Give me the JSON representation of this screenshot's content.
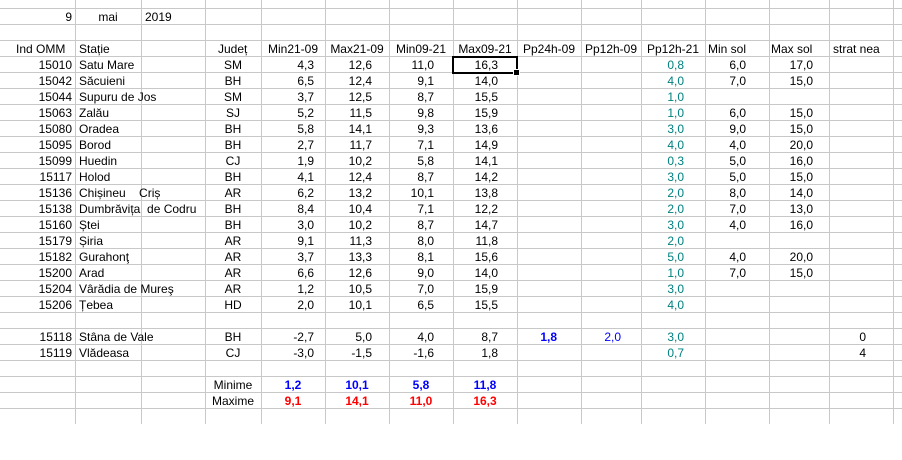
{
  "date": {
    "day": "9",
    "month": "mai",
    "year": "2019"
  },
  "headers": [
    "Ind OMM",
    "Stație",
    "Județ",
    "Min21-09",
    "Max21-09",
    "Min09-21",
    "Max09-21",
    "Pp24h-09",
    "Pp12h-09",
    "Pp12h-21",
    "Min sol",
    "Max sol",
    "strat nea"
  ],
  "rows": [
    {
      "id": "15010",
      "name": "Satu Mare",
      "county": "SM",
      "min21": "4,3",
      "max21": "12,6",
      "min09": "11,0",
      "max09": "16,3",
      "pp24": "",
      "pp12a": "",
      "pp12b": "0,8",
      "minsol": "6,0",
      "maxsol": "17,0",
      "snow": ""
    },
    {
      "id": "15042",
      "name": "Săcuieni",
      "county": "BH",
      "min21": "6,5",
      "max21": "12,4",
      "min09": "9,1",
      "max09": "14,0",
      "pp24": "",
      "pp12a": "",
      "pp12b": "4,0",
      "minsol": "7,0",
      "maxsol": "15,0",
      "snow": ""
    },
    {
      "id": "15044",
      "name": "Supuru de Jos",
      "county": "SM",
      "min21": "3,7",
      "max21": "12,5",
      "min09": "8,7",
      "max09": "15,5",
      "pp24": "",
      "pp12a": "",
      "pp12b": "1,0",
      "minsol": "",
      "maxsol": "",
      "snow": ""
    },
    {
      "id": "15063",
      "name": "Zalău",
      "county": "SJ",
      "min21": "5,2",
      "max21": "11,5",
      "min09": "9,8",
      "max09": "15,9",
      "pp24": "",
      "pp12a": "",
      "pp12b": "1,0",
      "minsol": "6,0",
      "maxsol": "15,0",
      "snow": ""
    },
    {
      "id": "15080",
      "name": "Oradea",
      "county": "BH",
      "min21": "5,8",
      "max21": "14,1",
      "min09": "9,3",
      "max09": "13,6",
      "pp24": "",
      "pp12a": "",
      "pp12b": "3,0",
      "minsol": "9,0",
      "maxsol": "15,0",
      "snow": ""
    },
    {
      "id": "15095",
      "name": "Borod",
      "county": "BH",
      "min21": "2,7",
      "max21": "11,7",
      "min09": "7,1",
      "max09": "14,9",
      "pp24": "",
      "pp12a": "",
      "pp12b": "4,0",
      "minsol": "4,0",
      "maxsol": "20,0",
      "snow": ""
    },
    {
      "id": "15099",
      "name": "Huedin",
      "county": "CJ",
      "min21": "1,9",
      "max21": "10,2",
      "min09": "5,8",
      "max09": "14,1",
      "pp24": "",
      "pp12a": "",
      "pp12b": "0,3",
      "minsol": "5,0",
      "maxsol": "16,0",
      "snow": ""
    },
    {
      "id": "15117",
      "name": "Holod",
      "county": "BH",
      "min21": "4,1",
      "max21": "12,4",
      "min09": "8,7",
      "max09": "14,2",
      "pp24": "",
      "pp12a": "",
      "pp12b": "3,0",
      "minsol": "5,0",
      "maxsol": "15,0",
      "snow": ""
    },
    {
      "id": "15136",
      "name": "Chișineu    Criș",
      "county": "AR",
      "min21": "6,2",
      "max21": "13,2",
      "min09": "10,1",
      "max09": "13,8",
      "pp24": "",
      "pp12a": "",
      "pp12b": "2,0",
      "minsol": "8,0",
      "maxsol": "14,0",
      "snow": ""
    },
    {
      "id": "15138",
      "name": "Dumbrăvița  de Codru",
      "county": "BH",
      "min21": "8,4",
      "max21": "10,4",
      "min09": "7,1",
      "max09": "12,2",
      "pp24": "",
      "pp12a": "",
      "pp12b": "2,0",
      "minsol": "7,0",
      "maxsol": "13,0",
      "snow": ""
    },
    {
      "id": "15160",
      "name": "Ștei",
      "county": "BH",
      "min21": "3,0",
      "max21": "10,2",
      "min09": "8,7",
      "max09": "14,7",
      "pp24": "",
      "pp12a": "",
      "pp12b": "3,0",
      "minsol": "4,0",
      "maxsol": "16,0",
      "snow": ""
    },
    {
      "id": "15179",
      "name": "Șiria",
      "county": "AR",
      "min21": "9,1",
      "max21": "11,3",
      "min09": "8,0",
      "max09": "11,8",
      "pp24": "",
      "pp12a": "",
      "pp12b": "2,0",
      "minsol": "",
      "maxsol": "",
      "snow": ""
    },
    {
      "id": "15182",
      "name": "Gurahonţ",
      "county": "AR",
      "min21": "3,7",
      "max21": "13,3",
      "min09": "8,1",
      "max09": "15,6",
      "pp24": "",
      "pp12a": "",
      "pp12b": "5,0",
      "minsol": "4,0",
      "maxsol": "20,0",
      "snow": ""
    },
    {
      "id": "15200",
      "name": "Arad",
      "county": "AR",
      "min21": "6,6",
      "max21": "12,6",
      "min09": "9,0",
      "max09": "14,0",
      "pp24": "",
      "pp12a": "",
      "pp12b": "1,0",
      "minsol": "7,0",
      "maxsol": "15,0",
      "snow": ""
    },
    {
      "id": "15204",
      "name": "Vârădia de Mureş",
      "county": "AR",
      "min21": "1,2",
      "max21": "10,5",
      "min09": "7,0",
      "max09": "15,9",
      "pp24": "",
      "pp12a": "",
      "pp12b": "3,0",
      "minsol": "",
      "maxsol": "",
      "snow": ""
    },
    {
      "id": "15206",
      "name": "Țebea",
      "county": "HD",
      "min21": "2,0",
      "max21": "10,1",
      "min09": "6,5",
      "max09": "15,5",
      "pp24": "",
      "pp12a": "",
      "pp12b": "4,0",
      "minsol": "",
      "maxsol": "",
      "snow": ""
    },
    {
      "id": "",
      "name": "",
      "county": "",
      "min21": "",
      "max21": "",
      "min09": "",
      "max09": "",
      "pp24": "",
      "pp12a": "",
      "pp12b": "",
      "minsol": "",
      "maxsol": "",
      "snow": ""
    },
    {
      "id": "15118",
      "name": "Stâna de Vale",
      "county": "BH",
      "min21": "-2,7",
      "max21": "5,0",
      "min09": "4,0",
      "max09": "8,7",
      "pp24": "1,8",
      "pp12a": "2,0",
      "pp12b": "3,0",
      "minsol": "",
      "maxsol": "",
      "snow": "0"
    },
    {
      "id": "15119",
      "name": "Vlădeasa",
      "county": "CJ",
      "min21": "-3,0",
      "max21": "-1,5",
      "min09": "-1,6",
      "max09": "1,8",
      "pp24": "",
      "pp12a": "",
      "pp12b": "0,7",
      "minsol": "",
      "maxsol": "",
      "snow": "4"
    }
  ],
  "summary": {
    "min_label": "Minime",
    "max_label": "Maxime",
    "min_values": [
      "1,2",
      "10,1",
      "5,8",
      "11,8"
    ],
    "max_values": [
      "9,1",
      "14,1",
      "11,0",
      "16,3"
    ]
  },
  "colors": {
    "gridline": "#c8c8c8",
    "precip": "#008080",
    "minime": "#0000ff",
    "maxime": "#ff0000"
  }
}
